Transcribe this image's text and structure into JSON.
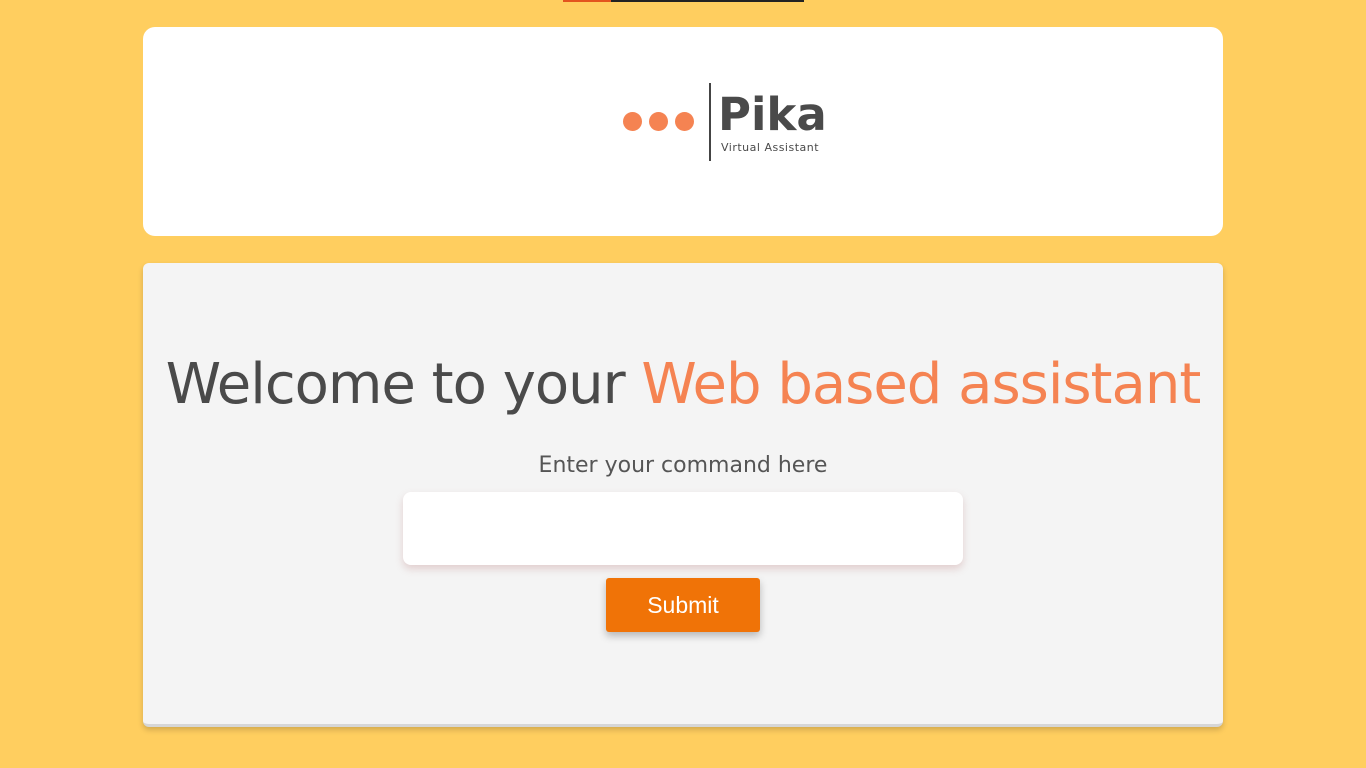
{
  "logo": {
    "name": "Pika",
    "subtitle": "Virtual Assistant",
    "dot_color": "#F58352"
  },
  "main": {
    "heading_prefix": "Welcome to your ",
    "heading_accent": "Web based assistant",
    "command_label": "Enter your command here",
    "command_value": "",
    "command_placeholder": "",
    "submit_label": "Submit"
  },
  "colors": {
    "background": "#FFCE5F",
    "accent": "#F58352",
    "button": "#F07307",
    "text": "#4A4A4A"
  }
}
